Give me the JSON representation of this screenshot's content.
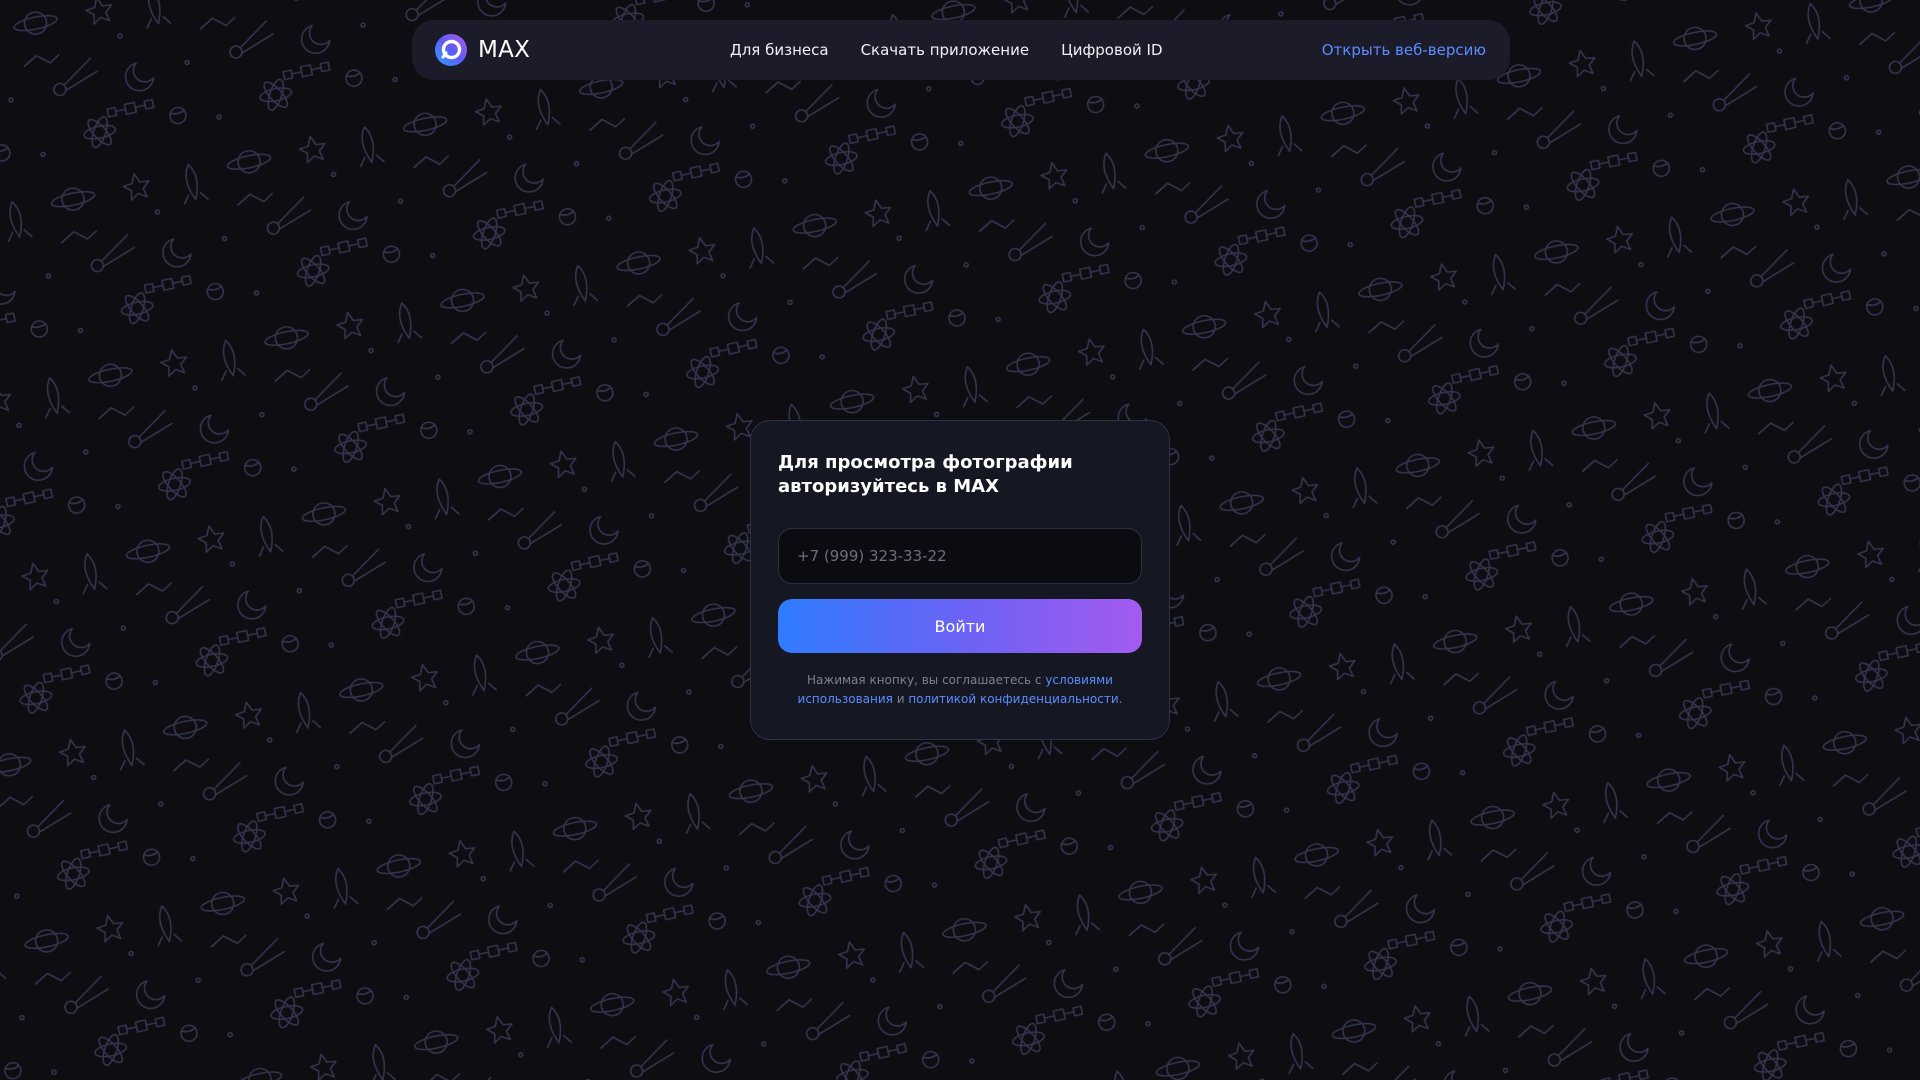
{
  "brand": {
    "name": "MAX"
  },
  "nav": {
    "links": [
      {
        "label": "Для бизнеса"
      },
      {
        "label": "Скачать приложение"
      },
      {
        "label": "Цифровой ID"
      }
    ],
    "web_version": "Открыть веб-версию"
  },
  "login": {
    "title": "Для просмотра фотографии авторизуйтесь в MAX",
    "phone_placeholder": "+7 (999) 323-33-22",
    "phone_value": "",
    "submit_label": "Войти",
    "terms": {
      "prefix": "Нажимая кнопку, вы соглашаетесь с ",
      "terms_link": "условиями использования",
      "middle": " и ",
      "privacy_link": "политикой конфиденциальности",
      "suffix": "."
    }
  },
  "colors": {
    "background": "#0d0d12",
    "pattern_stroke": "#3a3a5a",
    "nav_bg": "#1c1b29",
    "card_bg": "#151722",
    "link": "#5b8cff",
    "button_gradient_start": "#2f7cff",
    "button_gradient_end": "#a45bef"
  },
  "icons": {
    "logo": "max-logo-icon",
    "background_pattern": "space-doodle-pattern"
  }
}
